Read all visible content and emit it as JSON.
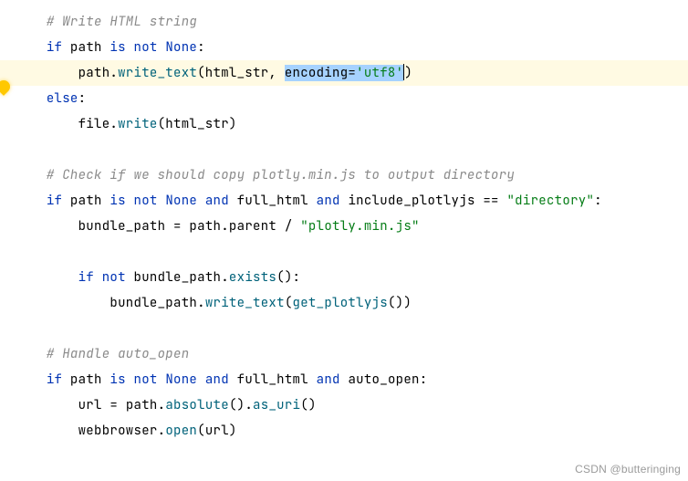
{
  "code": {
    "indent1": "    ",
    "indent2": "        ",
    "indent3": "            ",
    "comment1": "# Write HTML string",
    "l2_kw": "if ",
    "l2_id": "path ",
    "l2_isnot": "is not ",
    "l2_none": "None",
    "l2_colon": ":",
    "l3_pre": "path.",
    "l3_fn": "write_text",
    "l3_open": "(html_str, ",
    "l3_sel_kw": "encoding",
    "l3_sel_eq": "=",
    "l3_sel_str": "'utf8'",
    "l3_close": ")",
    "l4_else": "else",
    "l4_colon": ":",
    "l5_pre": "file.",
    "l5_fn": "write",
    "l5_args": "(html_str)",
    "comment2": "# Check if we should copy plotly.min.js to output directory",
    "l8_if": "if ",
    "l8_id1": "path ",
    "l8_isnot": "is not ",
    "l8_none": "None",
    "l8_and1": " and ",
    "l8_id2": "full_html",
    "l8_and2": " and ",
    "l8_id3": "include_plotlyjs ",
    "l8_eq": "== ",
    "l8_str": "\"directory\"",
    "l8_colon": ":",
    "l9_bp": "bundle_path ",
    "l9_eq": "= ",
    "l9_pp": "path.parent ",
    "l9_op": "/ ",
    "l9_str": "\"plotly.min.js\"",
    "l11_if": "if not ",
    "l11_bp": "bundle_path.",
    "l11_fn": "exists",
    "l11_p": "():",
    "l12_bp": "bundle_path.",
    "l12_fn": "write_text",
    "l12_open": "(",
    "l12_gp": "get_plotlyjs",
    "l12_close": "())",
    "comment3": "# Handle auto_open",
    "l15_if": "if ",
    "l15_id1": "path ",
    "l15_isnot": "is not ",
    "l15_none": "None",
    "l15_and1": " and ",
    "l15_id2": "full_html",
    "l15_and2": " and ",
    "l15_id3": "auto_open",
    "l15_colon": ":",
    "l16_url": "url ",
    "l16_eq": "= ",
    "l16_pre": "path.",
    "l16_fn1": "absolute",
    "l16_mid": "().",
    "l16_fn2": "as_uri",
    "l16_p": "()",
    "l17_wb": "webbrowser.",
    "l17_fn": "open",
    "l17_args": "(url)"
  },
  "watermark": "CSDN @butteringing"
}
